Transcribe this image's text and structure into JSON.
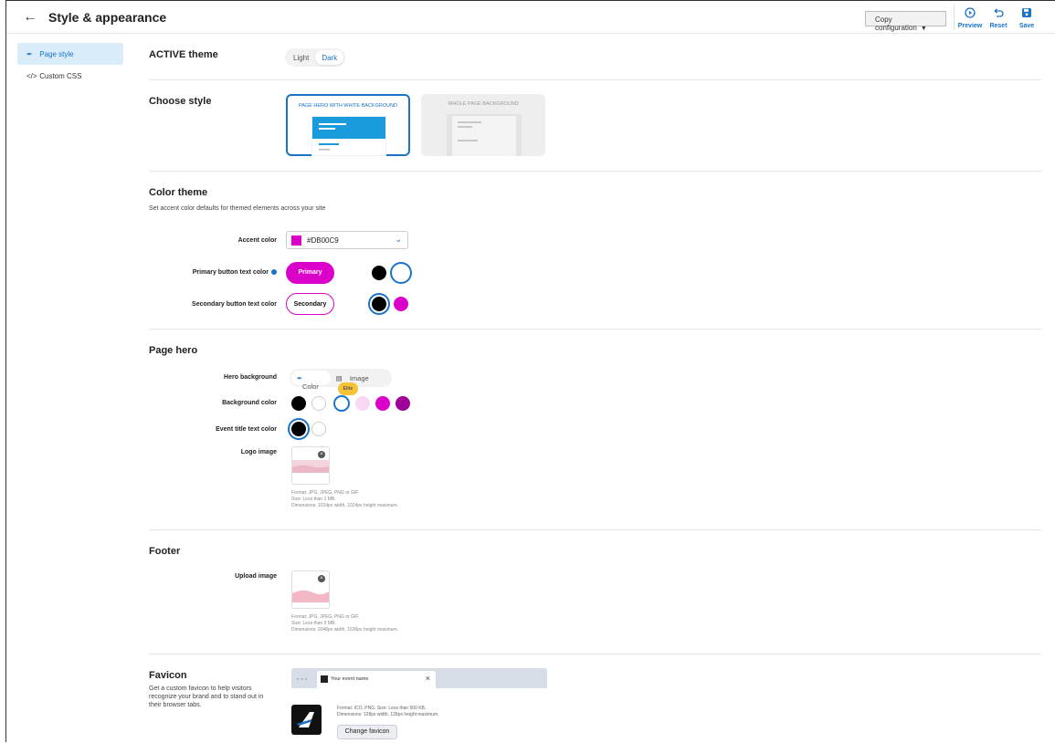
{
  "header": {
    "back_icon": "arrow-left-icon",
    "title": "Style & appearance",
    "copy_config": "Copy configuration",
    "preview": "Preview",
    "reset": "Reset",
    "save": "Save"
  },
  "sidebar": {
    "items": [
      {
        "label": "Page style",
        "icon": "brush-icon",
        "active": true
      },
      {
        "label": "Custom CSS",
        "icon": "code-icon",
        "active": false
      }
    ]
  },
  "active_theme": {
    "title": "ACTIVE theme",
    "options": [
      "Light",
      "Dark"
    ],
    "selected": "Dark"
  },
  "choose_style": {
    "title": "Choose style",
    "options": [
      "PAGE HERO WITH WHITE BACKGROUND",
      "WHOLE PAGE BACKGROUND"
    ],
    "selected": "PAGE HERO WITH WHITE BACKGROUND"
  },
  "color_theme": {
    "title": "Color theme",
    "description": "Set accent color defaults for themed elements across your site",
    "accent_label": "Accent color",
    "accent_value": "#DB00C9",
    "primary_label": "Primary button text color",
    "primary_button": "Primary",
    "secondary_label": "Secondary button text color",
    "secondary_button": "Secondary",
    "colors": {
      "accent": "#DB00C9",
      "brand_blue": "#1a73c9"
    }
  },
  "page_hero": {
    "title": "Page hero",
    "hero_bg_label": "Hero background",
    "hero_bg_options": [
      "Color",
      "Image"
    ],
    "hero_bg_selected": "Color",
    "elite_badge": "Elite",
    "bg_color_label": "Background color",
    "bg_colors": [
      "#000000",
      "#ffffff",
      "#ffffff",
      "#f7d9f3",
      "#DB00C9",
      "#a0009a"
    ],
    "event_title_label": "Event title text color",
    "event_title_colors": [
      "#000000",
      "#ffffff"
    ],
    "logo_label": "Logo image",
    "logo_hint": [
      "Format: JPG, JPEG, PNG or GIF.",
      "Size: Less than 1 MB.",
      "Dimensions: 1024px width, 1024px height maximum."
    ]
  },
  "footer": {
    "title": "Footer",
    "upload_label": "Upload image",
    "hint": [
      "Format: JPG, JPEG, PNG or GIF.",
      "Size: Less than 3 MB.",
      "Dimensions: 2048px width, 1536px height maximum."
    ]
  },
  "favicon": {
    "title": "Favicon",
    "description": "Get a custom favicon to help visitors recognize your brand and to stand out in their browser tabs.",
    "tab_label": "Your event name",
    "hint": [
      "Format: ICO, PNG. Size: Less than 500 KB.",
      "Dimensions: 128px width, 128px height maximum."
    ],
    "change_button": "Change favicon"
  }
}
